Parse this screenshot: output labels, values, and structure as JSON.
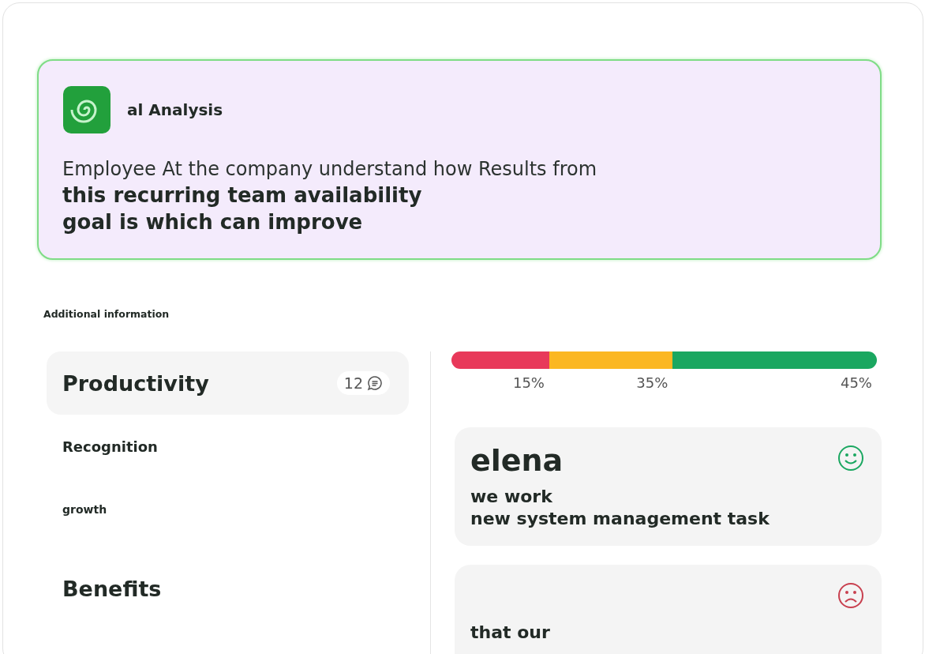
{
  "hero": {
    "title": "al Analysis",
    "lead": "Employee At the company understand how Results from",
    "headline": [
      "this recurring team availability",
      "goal is which can improve"
    ]
  },
  "section_title": "Additional information",
  "categories": [
    {
      "label": "Productivity",
      "kind": "featured",
      "count": "12"
    },
    {
      "label": "Recognition",
      "kind": "medium"
    },
    {
      "label": "growth",
      "kind": "small"
    },
    {
      "label": "Benefits",
      "kind": "large"
    }
  ],
  "distribution": [
    {
      "color": "#e8395a",
      "label": "15%"
    },
    {
      "color": "#fbb722",
      "label": "35%"
    },
    {
      "color": "#1aa760",
      "label": "45%"
    }
  ],
  "feedback": [
    {
      "kind": "happy",
      "name": "elena",
      "lines": [
        "we work",
        "new system management task"
      ]
    },
    {
      "kind": "sad",
      "lines": [
        "that our"
      ]
    }
  ]
}
